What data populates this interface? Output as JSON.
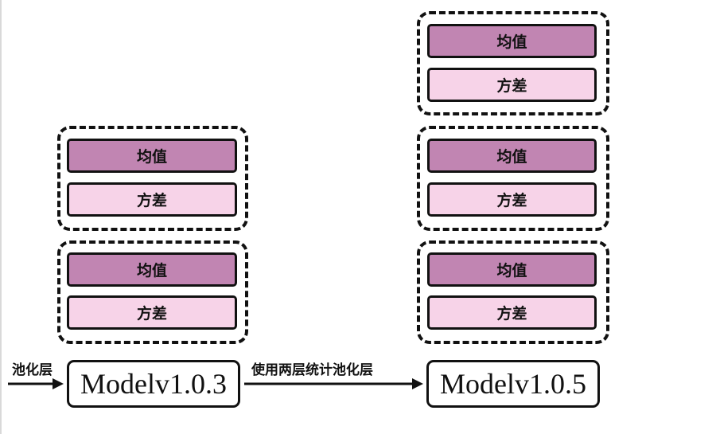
{
  "diagram": {
    "colors": {
      "mean_fill": "#c185b2",
      "variance_fill": "#f7d3e8",
      "stroke": "#111111"
    },
    "left_edge_label": "池化层",
    "middle_edge_label": "使用两层统计池化层",
    "model_a": {
      "label": "Modelv1.0.3",
      "groups": [
        {
          "mean": "均值",
          "variance": "方差"
        },
        {
          "mean": "均值",
          "variance": "方差"
        }
      ]
    },
    "model_b": {
      "label": "Modelv1.0.5",
      "groups": [
        {
          "mean": "均值",
          "variance": "方差"
        },
        {
          "mean": "均值",
          "variance": "方差"
        },
        {
          "mean": "均值",
          "variance": "方差"
        }
      ]
    }
  }
}
